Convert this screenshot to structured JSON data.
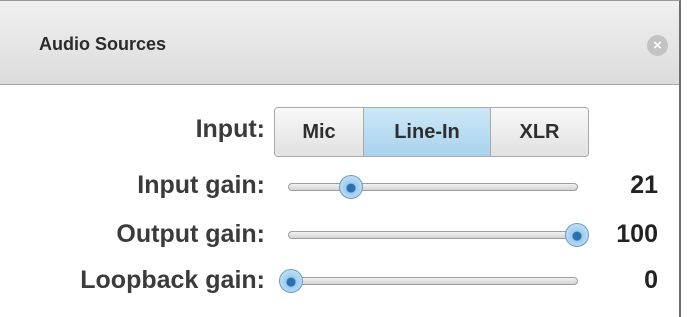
{
  "panel": {
    "title": "Audio Sources",
    "close_icon": "close-icon"
  },
  "input": {
    "label": "Input:",
    "options": [
      "Mic",
      "Line-In",
      "XLR"
    ],
    "selected": "Line-In"
  },
  "sliders": [
    {
      "label": "Input gain:",
      "value": "21",
      "level": 21
    },
    {
      "label": "Output gain:",
      "value": "100",
      "level": 100
    },
    {
      "label": "Loopback gain:",
      "value": "0",
      "level": 0
    }
  ],
  "colors": {
    "selected_segment": "#a9d2ee",
    "slider_thumb": "#2b6fb0"
  }
}
